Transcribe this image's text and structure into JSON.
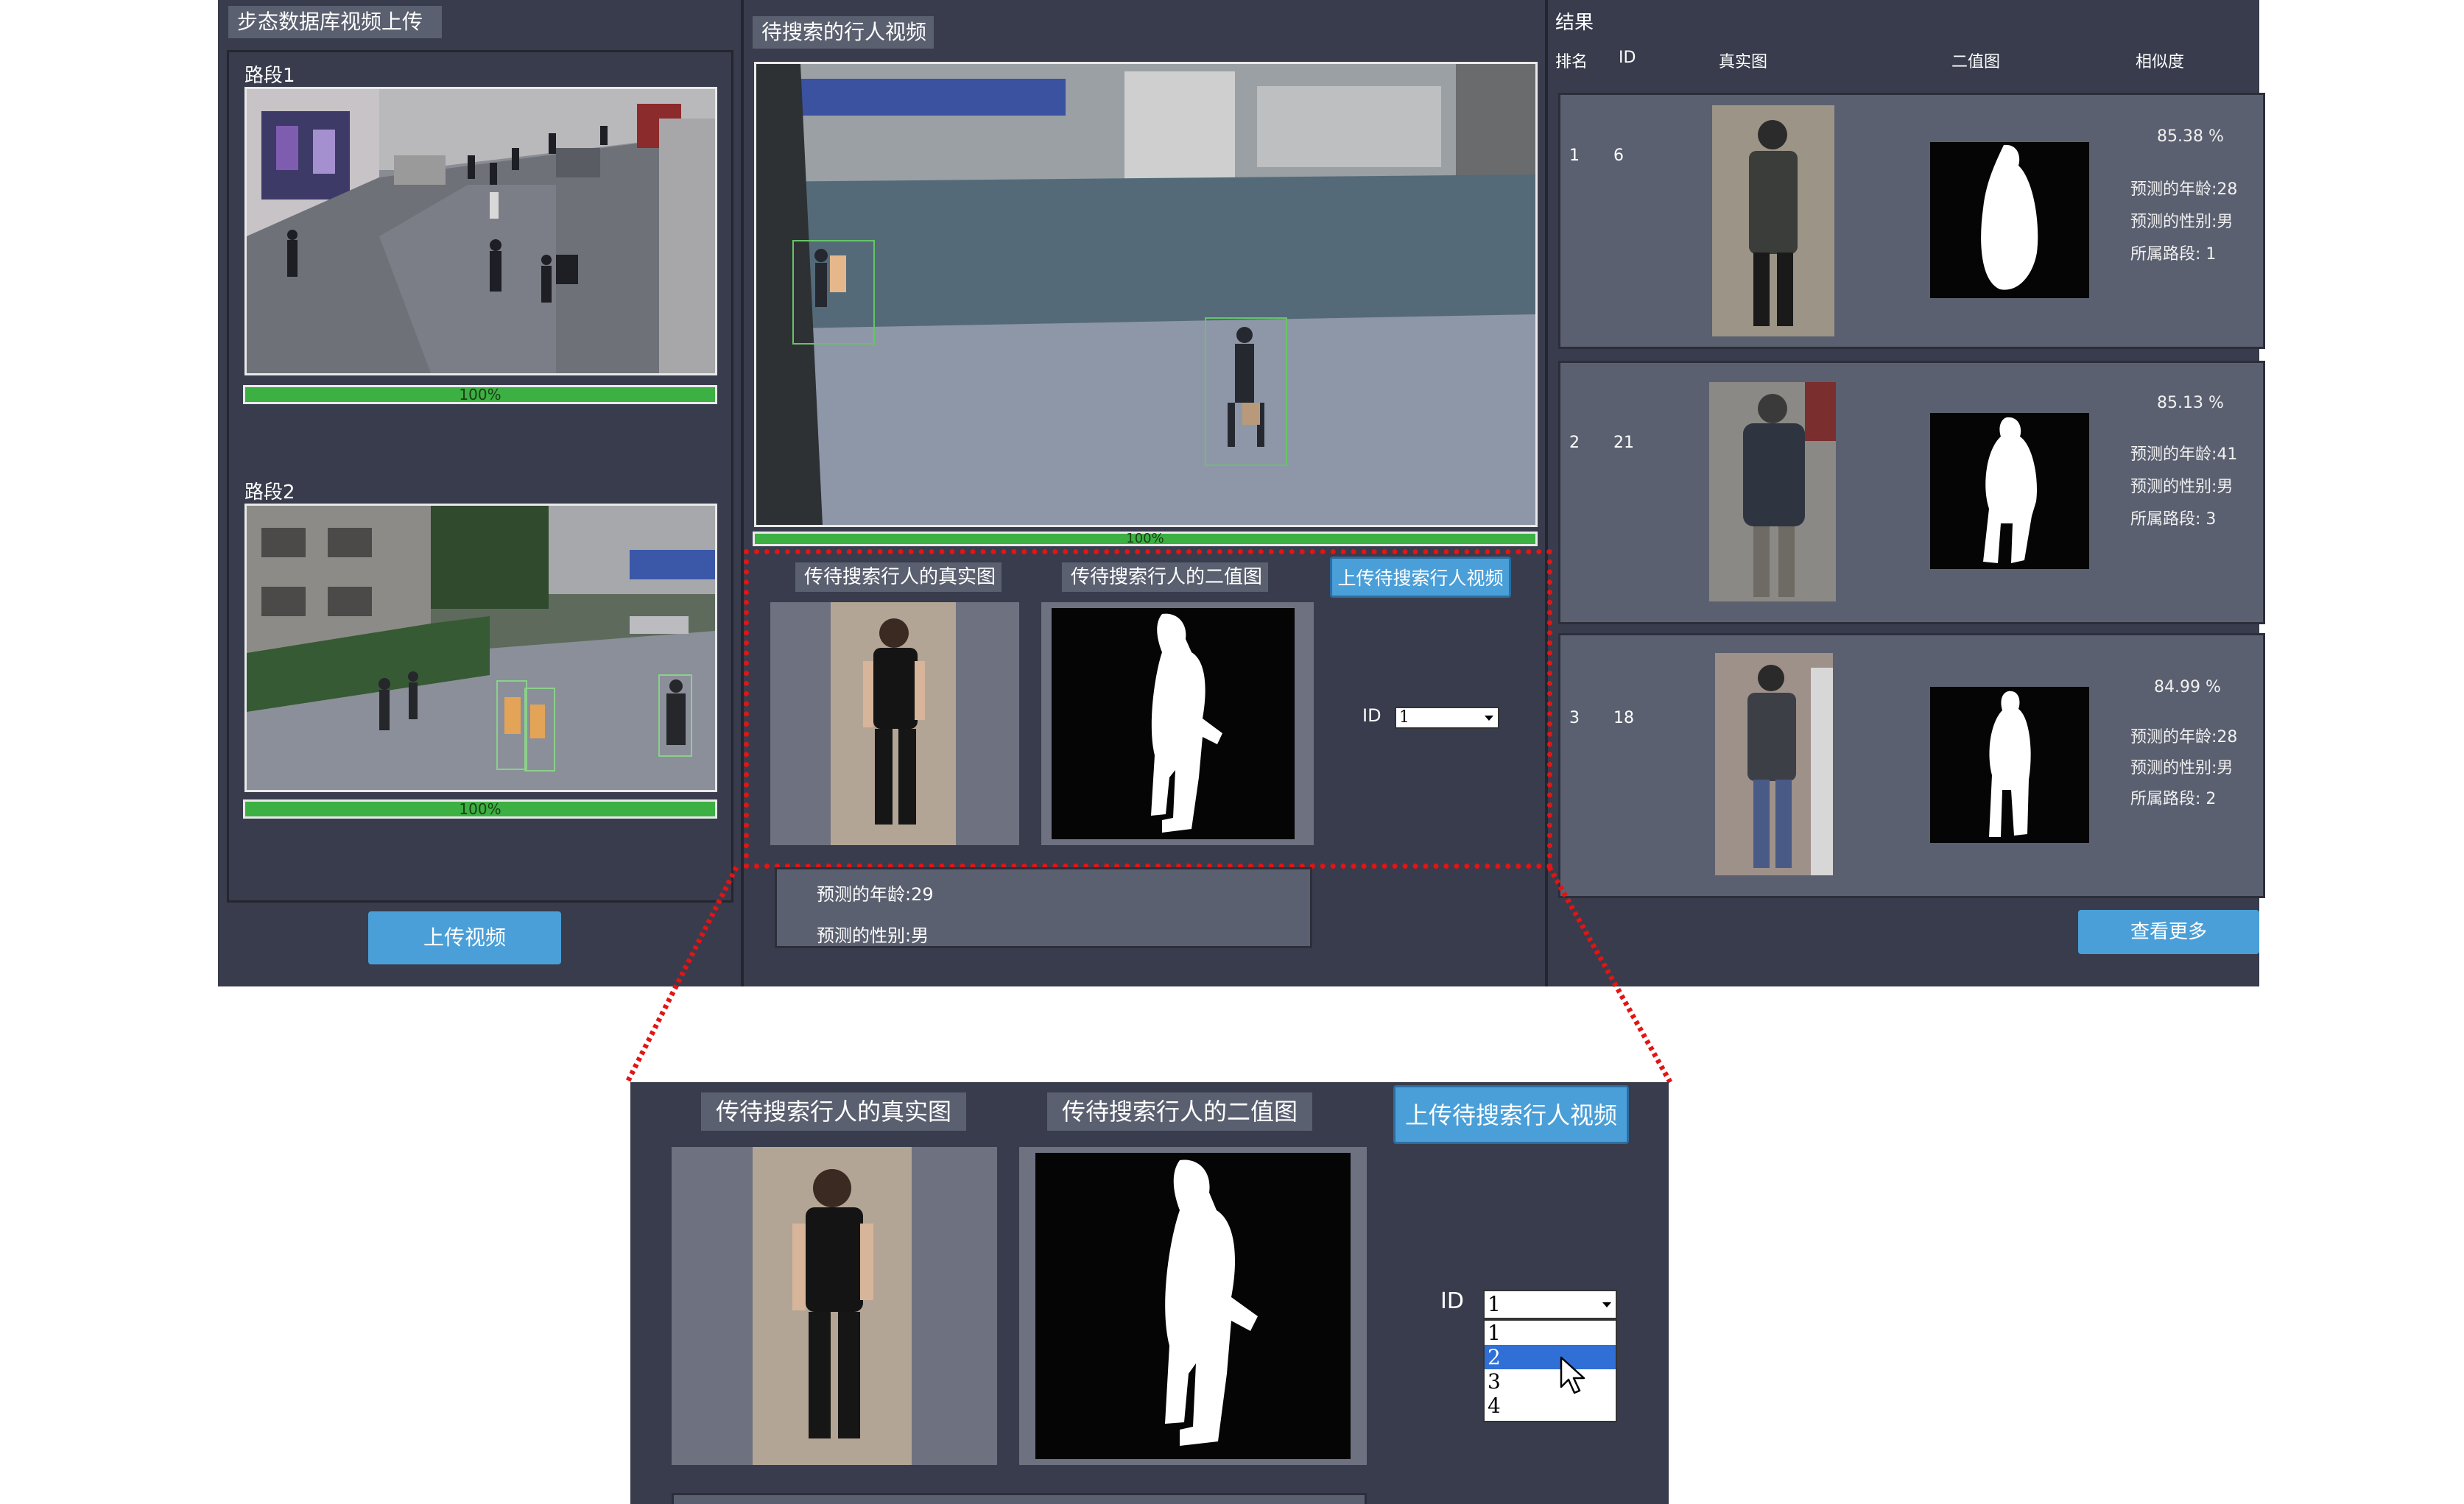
{
  "left_panel": {
    "title": "步态数据库视频上传",
    "segments": [
      {
        "label": "路段1",
        "progress_text": "100%",
        "progress": 1.0
      },
      {
        "label": "路段2",
        "progress_text": "100%",
        "progress": 1.0
      }
    ],
    "upload_button": "上传视频"
  },
  "middle_panel": {
    "title": "待搜索的行人视频",
    "progress_text": "100%",
    "progress": 1.0,
    "real_image_button": "传待搜索行人的真实图",
    "binary_image_button": "传待搜索行人的二值图",
    "upload_video_button": "上传待搜索行人视频",
    "id_label": "ID",
    "id_selected": "1",
    "predicted_age": "预测的年龄:29",
    "predicted_gender": "预测的性别:男"
  },
  "results": {
    "title": "结果",
    "headers": {
      "rank": "排名",
      "id": "ID",
      "real": "真实图",
      "binary": "二值图",
      "similarity": "相似度"
    },
    "rows": [
      {
        "rank": "1",
        "id": "6",
        "similarity": "85.38 %",
        "age": "预测的年龄:28",
        "gender": "预测的性别:男",
        "route": "所属路段:  1"
      },
      {
        "rank": "2",
        "id": "21",
        "similarity": "85.13  %",
        "age": "预测的年龄:41",
        "gender": "预测的性别:男",
        "route": "所属路段:  3"
      },
      {
        "rank": "3",
        "id": "18",
        "similarity": "84.99  %",
        "age": "预测的年龄:28",
        "gender": "预测的性别:男",
        "route": "所属路段:  2"
      }
    ],
    "more_button": "查看更多"
  },
  "zoom": {
    "real_image_button": "传待搜索行人的真实图",
    "binary_image_button": "传待搜索行人的二值图",
    "upload_video_button": "上传待搜索行人视频",
    "id_label": "ID",
    "id_selected": "1",
    "dropdown_options": [
      "1",
      "2",
      "3",
      "4"
    ],
    "dropdown_highlighted": "2"
  },
  "colors": {
    "app_bg": "#383c4c",
    "tab_bg": "#5b6070",
    "accent_blue": "#4a9fd8",
    "progress_green": "#3cb043",
    "highlight_red": "#e21414"
  }
}
